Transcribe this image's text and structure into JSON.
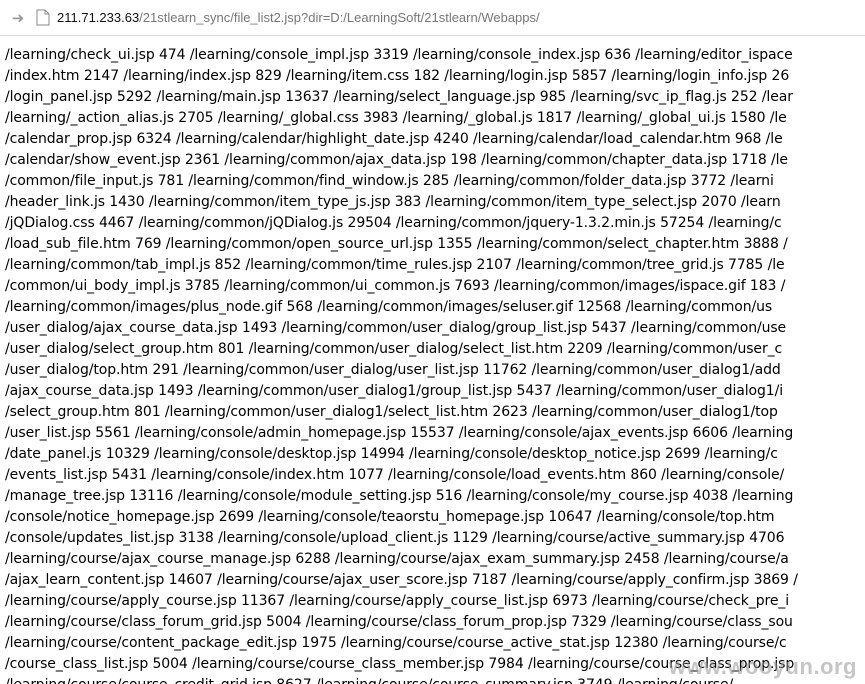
{
  "browser": {
    "url_host": "211.71.233.63",
    "url_path": "/21stlearn_sync/file_list2.jsp?dir=D:/LearningSoft/21stlearn/Webapps/",
    "nav_icon": "arrow-right-icon",
    "page_icon": "page-icon"
  },
  "listing": {
    "lines": [
      "/learning/check_ui.jsp 474 /learning/console_impl.jsp 3319 /learning/console_index.jsp 636 /learning/editor_ispace",
      "/index.htm 2147 /learning/index.jsp 829 /learning/item.css 182 /learning/login.jsp 5857 /learning/login_info.jsp 26",
      "/login_panel.jsp 5292 /learning/main.jsp 13637 /learning/select_language.jsp 985 /learning/svc_ip_flag.js 252 /lear",
      "/learning/_action_alias.js 2705 /learning/_global.css 3983 /learning/_global.js 1817 /learning/_global_ui.js 1580 /le",
      "/calendar_prop.jsp 6324 /learning/calendar/highlight_date.jsp 4240 /learning/calendar/load_calendar.htm 968 /le",
      "/calendar/show_event.jsp 2361 /learning/common/ajax_data.jsp 198 /learning/common/chapter_data.jsp 1718 /le",
      "/common/file_input.js 781 /learning/common/find_window.js 285 /learning/common/folder_data.jsp 3772 /learni",
      "/header_link.js 1430 /learning/common/item_type_js.jsp 383 /learning/common/item_type_select.jsp 2070 /learn",
      "/jQDialog.css 4467 /learning/common/jQDialog.js 29504 /learning/common/jquery-1.3.2.min.js 57254 /learning/c",
      "/load_sub_file.htm 769 /learning/common/open_source_url.jsp 1355 /learning/common/select_chapter.htm 3888 /",
      "/learning/common/tab_impl.js 852 /learning/common/time_rules.jsp 2107 /learning/common/tree_grid.js 7785 /le",
      "/common/ui_body_impl.js 3785 /learning/common/ui_common.js 7693 /learning/common/images/ispace.gif 183 /",
      "/learning/common/images/plus_node.gif 568 /learning/common/images/seluser.gif 12568 /learning/common/us",
      "/user_dialog/ajax_course_data.jsp 1493 /learning/common/user_dialog/group_list.jsp 5437 /learning/common/use",
      "/user_dialog/select_group.htm 801 /learning/common/user_dialog/select_list.htm 2209 /learning/common/user_c",
      "/user_dialog/top.htm 291 /learning/common/user_dialog/user_list.jsp 11762 /learning/common/user_dialog1/add",
      "/ajax_course_data.jsp 1493 /learning/common/user_dialog1/group_list.jsp 5437 /learning/common/user_dialog1/i",
      "/select_group.htm 801 /learning/common/user_dialog1/select_list.htm 2623 /learning/common/user_dialog1/top",
      "/user_list.jsp 5561 /learning/console/admin_homepage.jsp 15537 /learning/console/ajax_events.jsp 6606 /learning",
      "/date_panel.js 10329 /learning/console/desktop.jsp 14994 /learning/console/desktop_notice.jsp 2699 /learning/c",
      "/events_list.jsp 5431 /learning/console/index.htm 1077 /learning/console/load_events.htm 860 /learning/console/",
      "/manage_tree.jsp 13116 /learning/console/module_setting.jsp 516 /learning/console/my_course.jsp 4038 /learning",
      "/console/notice_homepage.jsp 2699 /learning/console/teaorstu_homepage.jsp 10647 /learning/console/top.htm",
      "/console/updates_list.jsp 3138 /learning/console/upload_client.js 1129 /learning/course/active_summary.jsp 4706",
      "/learning/course/ajax_course_manage.jsp 6288 /learning/course/ajax_exam_summary.jsp 2458 /learning/course/a",
      "/ajax_learn_content.jsp 14607 /learning/course/ajax_user_score.jsp 7187 /learning/course/apply_confirm.jsp 3869 /",
      "/learning/course/apply_course.jsp 11367 /learning/course/apply_course_list.jsp 6973 /learning/course/check_pre_i",
      "/learning/course/class_forum_grid.jsp 5004 /learning/course/class_forum_prop.jsp 7329 /learning/course/class_sou",
      "/learning/course/content_package_edit.jsp 1975 /learning/course/course_active_stat.jsp 12380 /learning/course/c",
      "/course_class_list.jsp 5004 /learning/course/course_class_member.jsp 7984 /learning/course/course_class_prop.jsp",
      "/learning/course/course_credit_grid.jsp 8627 /learning/course/course_summary.jsp 3749 /learning/course/"
    ]
  },
  "watermark": "www.wooyun.org"
}
